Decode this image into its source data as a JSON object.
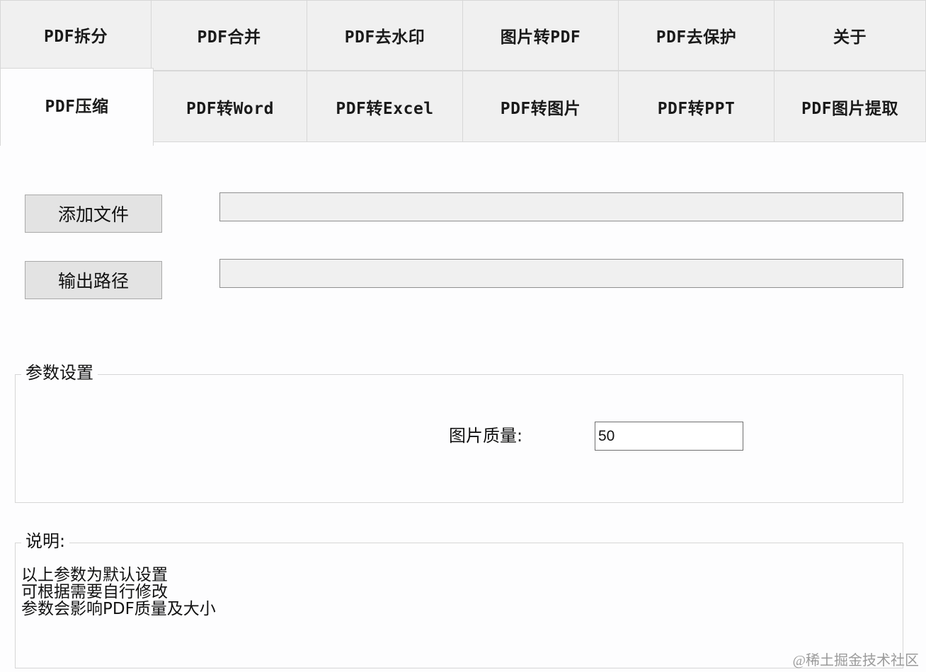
{
  "tabs": {
    "row1": [
      "PDF拆分",
      "PDF合并",
      "PDF去水印",
      "图片转PDF",
      "PDF去保护",
      "关于"
    ],
    "row2": [
      "PDF压缩",
      "PDF转Word",
      "PDF转Excel",
      "PDF转图片",
      "PDF转PPT",
      "PDF图片提取"
    ],
    "active": "PDF压缩"
  },
  "files": {
    "add_button": "添加文件",
    "output_button": "输出路径",
    "input_path": "",
    "output_path": ""
  },
  "params": {
    "group_title": "参数设置",
    "quality_label": "图片质量:",
    "quality_value": "50"
  },
  "notes": {
    "group_title": "说明:",
    "lines": [
      "以上参数为默认设置",
      "可根据需要自行修改",
      "参数会影响PDF质量及大小"
    ]
  },
  "watermark": "@稀土掘金技术社区"
}
